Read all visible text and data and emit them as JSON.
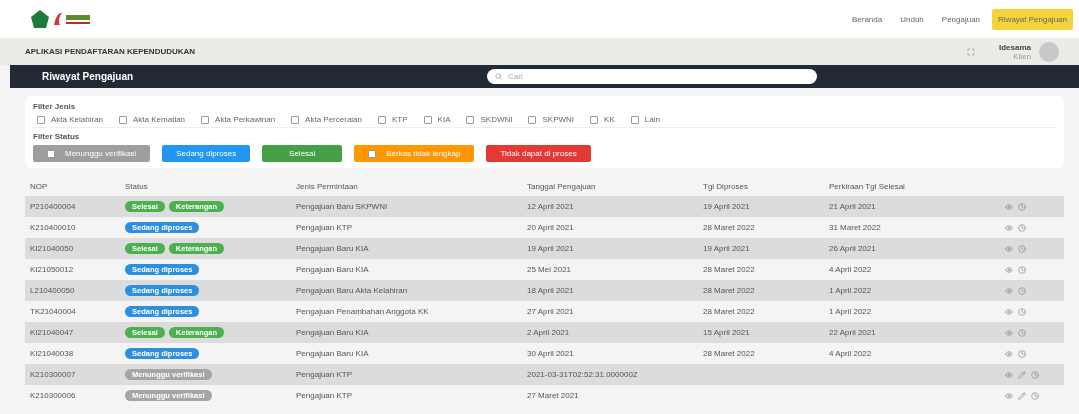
{
  "header": {
    "nav": [
      {
        "label": "Beranda",
        "selected": false
      },
      {
        "label": "Unduh",
        "selected": false
      },
      {
        "label": "Pengajuan",
        "selected": false
      },
      {
        "label": "Riwayat Pengajuan",
        "selected": true
      }
    ]
  },
  "app_bar": {
    "title": "APLIKASI PENDAFTARAN KEPENDUDUKAN",
    "user": {
      "name": "Idesama",
      "role": "Klien"
    }
  },
  "page": {
    "title": "Riwayat Pengajuan",
    "search": {
      "placeholder": "Cari"
    }
  },
  "filters": {
    "jenis_label": "Filter Jenis",
    "jenis": [
      {
        "label": "Akta Kelahiran",
        "checked": false
      },
      {
        "label": "Akta Kematian",
        "checked": false
      },
      {
        "label": "Akta Perkawinan",
        "checked": false
      },
      {
        "label": "Akta Perceraian",
        "checked": false
      },
      {
        "label": "KTP",
        "checked": false
      },
      {
        "label": "KIA",
        "checked": false
      },
      {
        "label": "SKDWNI",
        "checked": false
      },
      {
        "label": "SKPWNI",
        "checked": false
      },
      {
        "label": "KK",
        "checked": false
      },
      {
        "label": "Lain",
        "checked": false
      }
    ],
    "status_label": "Filter Status",
    "status": [
      {
        "label": "Menunggu verifikasi",
        "color": "#9e9e9e",
        "checked": false
      },
      {
        "label": "Sedang diproses",
        "color": "#2196f3"
      },
      {
        "label": "Selesai",
        "color": "#43a047"
      },
      {
        "label": "Berkas tidak lengkap",
        "color": "#ff9800",
        "checked": false
      },
      {
        "label": "Tidak dapat di proses",
        "color": "#e53935"
      }
    ]
  },
  "table": {
    "columns": [
      "NOP",
      "Status",
      "Jenis Permintaan",
      "Tanggal Pengajuan",
      "Tgl Diproses",
      "Perkiraan Tgl Selesai"
    ],
    "rows": [
      {
        "nop": "P210400004",
        "badges": [
          {
            "kind": "done",
            "label": "Selesai"
          },
          {
            "kind": "note",
            "label": "Keterangan"
          }
        ],
        "jenis": "Pengajuan Baru SKPWNI",
        "tanggal": "12 April 2021",
        "diproses": "19 April 2021",
        "selesai": "21 April 2021",
        "actions": [
          {
            "kind": "view"
          },
          {
            "kind": "history"
          }
        ]
      },
      {
        "nop": "K210400010",
        "badges": [
          {
            "kind": "process",
            "label": "Sedang diproses"
          }
        ],
        "jenis": "Pengajuan KTP",
        "tanggal": "20 April 2021",
        "diproses": "28 Maret 2022",
        "selesai": "31 Maret 2022",
        "actions": [
          {
            "kind": "view"
          },
          {
            "kind": "history"
          }
        ]
      },
      {
        "nop": "KI21040050",
        "badges": [
          {
            "kind": "done",
            "label": "Selesai"
          },
          {
            "kind": "note",
            "label": "Keterangan"
          }
        ],
        "jenis": "Pengajuan Baru KIA",
        "tanggal": "19 April 2021",
        "diproses": "19 April 2021",
        "selesai": "26 April 2021",
        "actions": [
          {
            "kind": "view"
          },
          {
            "kind": "history"
          }
        ]
      },
      {
        "nop": "KI21050012",
        "badges": [
          {
            "kind": "process",
            "label": "Sedang diproses"
          }
        ],
        "jenis": "Pengajuan Baru KIA",
        "tanggal": "25 Mei 2021",
        "diproses": "28 Maret 2022",
        "selesai": "4 April 2022",
        "actions": [
          {
            "kind": "view"
          },
          {
            "kind": "history"
          }
        ]
      },
      {
        "nop": "L210400050",
        "badges": [
          {
            "kind": "process",
            "label": "Sedang diproses"
          }
        ],
        "jenis": "Pengajuan Baru Akta Kelahiran",
        "tanggal": "18 April 2021",
        "diproses": "28 Maret 2022",
        "selesai": "1 April 2022",
        "actions": [
          {
            "kind": "view"
          },
          {
            "kind": "history"
          }
        ]
      },
      {
        "nop": "TK21040004",
        "badges": [
          {
            "kind": "process",
            "label": "Sedang diproses"
          }
        ],
        "jenis": "Pengajuan Penambahan Anggota KK",
        "tanggal": "27 April 2021",
        "diproses": "28 Maret 2022",
        "selesai": "1 April 2022",
        "actions": [
          {
            "kind": "view"
          },
          {
            "kind": "history"
          }
        ]
      },
      {
        "nop": "KI21040047",
        "badges": [
          {
            "kind": "done",
            "label": "Selesai"
          },
          {
            "kind": "note",
            "label": "Keterangan"
          }
        ],
        "jenis": "Pengajuan Baru KIA",
        "tanggal": "2 April 2021",
        "diproses": "15 April 2021",
        "selesai": "22 April 2021",
        "actions": [
          {
            "kind": "view"
          },
          {
            "kind": "history"
          }
        ]
      },
      {
        "nop": "KI21040038",
        "badges": [
          {
            "kind": "process",
            "label": "Sedang diproses"
          }
        ],
        "jenis": "Pengajuan Baru KIA",
        "tanggal": "30 April 2021",
        "diproses": "28 Maret 2022",
        "selesai": "4 April 2022",
        "actions": [
          {
            "kind": "view"
          },
          {
            "kind": "history"
          }
        ]
      },
      {
        "nop": "K210300007",
        "badges": [
          {
            "kind": "waiting",
            "label": "Menunggu verifikasi"
          }
        ],
        "jenis": "Pengajuan KTP",
        "tanggal": "2021-03-31T02:52:31.000000Z",
        "actions": [
          {
            "kind": "view"
          },
          {
            "kind": "edit"
          },
          {
            "kind": "history"
          }
        ]
      },
      {
        "nop": "K210300006",
        "badges": [
          {
            "kind": "waiting",
            "label": "Menunggu verifikasi"
          }
        ],
        "jenis": "Pengajuan KTP",
        "tanggal": "27 Maret 2021",
        "actions": [
          {
            "kind": "view"
          },
          {
            "kind": "edit"
          },
          {
            "kind": "history"
          }
        ]
      }
    ]
  }
}
